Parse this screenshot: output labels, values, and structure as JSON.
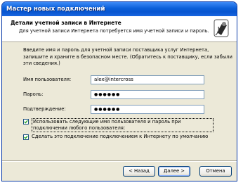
{
  "window": {
    "title": "Мастер новых подключений"
  },
  "header": {
    "title": "Детали учетной записи в Интернете",
    "subtitle": "Для учетной записи Интернета потребуется имя учетной записи и пароль."
  },
  "instructions": "Введите имя и пароль для учетной записи поставщика услуг Интернета, запишите и храните в безопасном месте. (Обратитесь к поставщику, если забыли эти сведения.)",
  "fields": {
    "username": {
      "label": "Имя пользователя:",
      "value": "alex@intercross"
    },
    "password": {
      "label": "Пароль:",
      "value": "●●●●●●"
    },
    "confirm": {
      "label": "Подтверждение:",
      "value": "●●●●●●"
    }
  },
  "checkboxes": {
    "use_for_all": {
      "label": "Использовать следующие имя пользователя и пароль при подключении любого пользователя:",
      "checked": true
    },
    "default_connection": {
      "label": "Сделать это подключение подключением к Интернету по умолчанию",
      "checked": true
    }
  },
  "buttons": {
    "back": "< Назад",
    "next": "Далее >",
    "cancel": "Отмена"
  }
}
